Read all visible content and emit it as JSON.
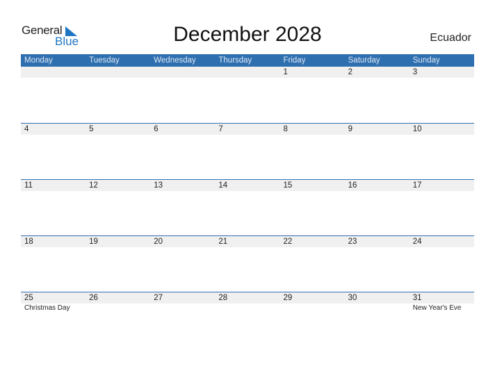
{
  "logo": {
    "general": "General",
    "blue": "Blue"
  },
  "title": "December 2028",
  "country": "Ecuador",
  "weekdays": [
    "Monday",
    "Tuesday",
    "Wednesday",
    "Thursday",
    "Friday",
    "Saturday",
    "Sunday"
  ],
  "weeks": [
    {
      "days": [
        "",
        "",
        "",
        "",
        "1",
        "2",
        "3"
      ],
      "holidays": [
        "",
        "",
        "",
        "",
        "",
        "",
        ""
      ]
    },
    {
      "days": [
        "4",
        "5",
        "6",
        "7",
        "8",
        "9",
        "10"
      ],
      "holidays": [
        "",
        "",
        "",
        "",
        "",
        "",
        ""
      ]
    },
    {
      "days": [
        "11",
        "12",
        "13",
        "14",
        "15",
        "16",
        "17"
      ],
      "holidays": [
        "",
        "",
        "",
        "",
        "",
        "",
        ""
      ]
    },
    {
      "days": [
        "18",
        "19",
        "20",
        "21",
        "22",
        "23",
        "24"
      ],
      "holidays": [
        "",
        "",
        "",
        "",
        "",
        "",
        ""
      ]
    },
    {
      "days": [
        "25",
        "26",
        "27",
        "28",
        "29",
        "30",
        "31"
      ],
      "holidays": [
        "Christmas Day",
        "",
        "",
        "",
        "",
        "",
        "New Year's Eve"
      ]
    }
  ],
  "colors": {
    "header": "#2e6fb0",
    "strip": "#f0f0f0",
    "brand_blue": "#1f77c4"
  }
}
